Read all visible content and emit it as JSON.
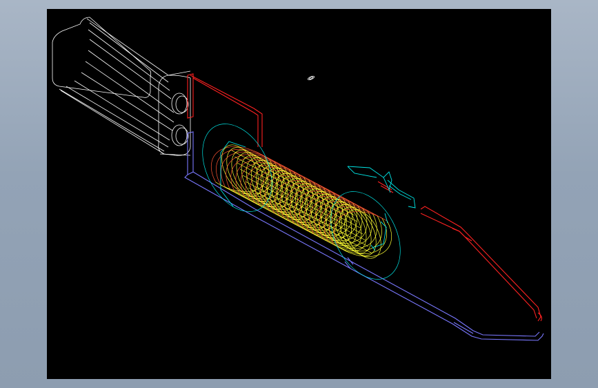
{
  "window": {
    "background_color": "#9aa9bb"
  },
  "viewport": {
    "background_color": "#000000",
    "model_colors": {
      "housing": "#ffffff",
      "hot_pipe": "#ff2222",
      "cold_pipe": "#7a78ff",
      "coil": "#ffff33",
      "coil_back": "#ff5533",
      "frame": "#00e6e6"
    }
  }
}
